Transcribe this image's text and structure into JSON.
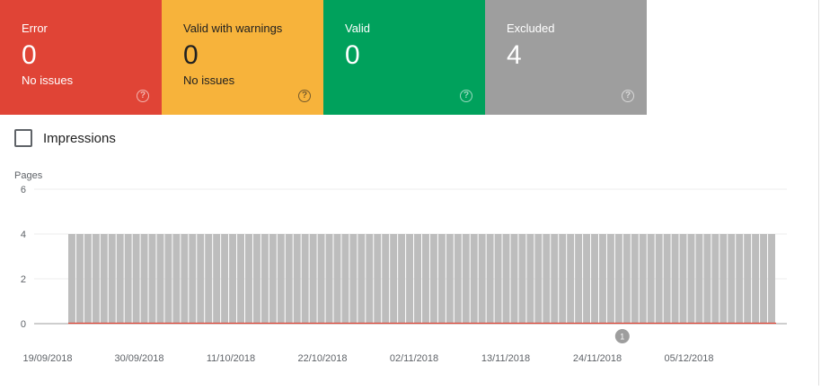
{
  "cards": [
    {
      "key": "error",
      "label": "Error",
      "count": "0",
      "sub": "No issues",
      "help_icon": "help-circle-icon",
      "color": "#e04436"
    },
    {
      "key": "warning",
      "label": "Valid with warnings",
      "count": "0",
      "sub": "No issues",
      "help_icon": "help-circle-icon",
      "color": "#f7b33b"
    },
    {
      "key": "valid",
      "label": "Valid",
      "count": "0",
      "sub": "",
      "help_icon": "help-circle-icon",
      "color": "#00a15c"
    },
    {
      "key": "excluded",
      "label": "Excluded",
      "count": "4",
      "sub": "",
      "help_icon": "help-circle-icon",
      "color": "#9e9e9e"
    }
  ],
  "impressions": {
    "label": "Impressions",
    "checked": false
  },
  "chart_data": {
    "type": "bar",
    "ylabel": "Pages",
    "ylim": [
      0,
      6
    ],
    "yticks": [
      "0",
      "2",
      "4",
      "6"
    ],
    "x_start": "19/09/2018",
    "xticks": [
      "19/09/2018",
      "30/09/2018",
      "11/10/2018",
      "22/10/2018",
      "02/11/2018",
      "13/11/2018",
      "24/11/2018",
      "05/12/2018"
    ],
    "series": [
      {
        "values": [
          4,
          4,
          4,
          4,
          4,
          4,
          4,
          4,
          4,
          4,
          4,
          4,
          4,
          4,
          4,
          4,
          4,
          4,
          4,
          4,
          4,
          4,
          4,
          4,
          4,
          4,
          4,
          4,
          4,
          4,
          4,
          4,
          4,
          4,
          4,
          4,
          4,
          4,
          4,
          4,
          4,
          4,
          4,
          4,
          4,
          4,
          4,
          4,
          4,
          4,
          4,
          4,
          4,
          4,
          4,
          4,
          4,
          4,
          4,
          4,
          4,
          4,
          4,
          4,
          4,
          4,
          4,
          4,
          4,
          4,
          4,
          4,
          4,
          4,
          4,
          4,
          4,
          4,
          4,
          4,
          4,
          4,
          4,
          4,
          4,
          4,
          4,
          4
        ],
        "color": "#bdbdbd"
      },
      {
        "values": [
          0,
          0,
          0,
          0,
          0,
          0,
          0,
          0,
          0,
          0,
          0,
          0,
          0,
          0,
          0,
          0,
          0,
          0,
          0,
          0,
          0,
          0,
          0,
          0,
          0,
          0,
          0,
          0,
          0,
          0,
          0,
          0,
          0,
          0,
          0,
          0,
          0,
          0,
          0,
          0,
          0,
          0,
          0,
          0,
          0,
          0,
          0,
          0,
          0,
          0,
          0,
          0,
          0,
          0,
          0,
          0,
          0,
          0,
          0,
          0,
          0,
          0,
          0,
          0,
          0,
          0,
          0,
          0,
          0,
          0,
          0,
          0,
          0,
          0,
          0,
          0,
          0,
          0,
          0,
          0,
          0,
          0,
          0,
          0,
          0,
          0,
          0,
          0
        ],
        "color": "#e04436"
      }
    ],
    "annotations": [
      {
        "label": "1",
        "x": "27/11/2018"
      }
    ],
    "grid": true,
    "legend": "none"
  }
}
